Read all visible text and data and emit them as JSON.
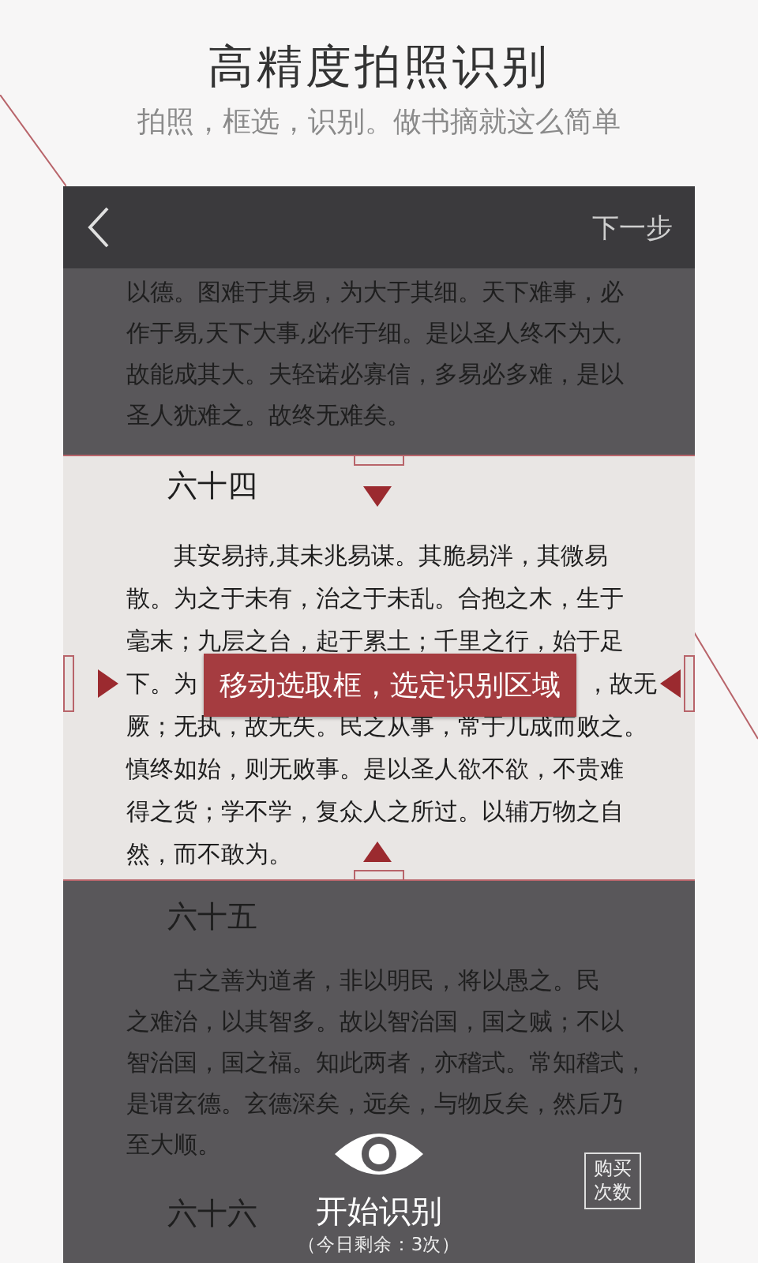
{
  "promo": {
    "title": "高精度拍照识别",
    "subtitle": "拍照，框选，识别。做书摘就这么简单"
  },
  "toolbar": {
    "next": "下一步"
  },
  "text_above": {
    "lines": [
      {
        "text": "以德。图难于其易，为大于其细。天下难事，必",
        "indent": false
      },
      {
        "text": "作于易,天下大事,必作于细。是以圣人终不为大,",
        "indent": false
      },
      {
        "text": "故能成其大。夫轻诺必寡信，多易必多难，是以",
        "indent": false
      },
      {
        "text": "圣人犹难之。故终无难矣。",
        "indent": false
      }
    ]
  },
  "selection": {
    "heading": "六十四",
    "lines_before": [
      {
        "text": "其安易持,其未兆易谋。其脆易泮，其微易",
        "indent": true
      },
      {
        "text": "散。为之于未有，治之于未乱。合抱之木，生于",
        "indent": false
      },
      {
        "text": "毫末；九层之台，起于累土；千里之行，始于足",
        "indent": false
      }
    ],
    "covered_line": {
      "before": "下。为",
      "after": "，故无"
    },
    "tooltip": "移动选取框，选定识别区域",
    "lines_after": [
      {
        "text": "厥；无执，故无失。民之从事，常于几成而败之。",
        "indent": false
      },
      {
        "text": "慎终如始，则无败事。是以圣人欲不欲，不贵难",
        "indent": false
      },
      {
        "text": "得之货；学不学，复众人之所过。以辅万物之自",
        "indent": false
      },
      {
        "text": "然，而不敢为。",
        "indent": false
      }
    ]
  },
  "text_below": {
    "heading": "六十五",
    "lines": [
      {
        "text": "古之善为道者，非以明民，将以愚之。民",
        "indent": true
      },
      {
        "text": "之难治，以其智多。故以智治国，国之贼；不以",
        "indent": false
      },
      {
        "text": "智治国，国之福。知此两者，亦稽式。常知稽式，",
        "indent": false
      },
      {
        "text": "是谓玄德。玄德深矣，远矣，与物反矣，然后乃",
        "indent": false
      },
      {
        "text": "至大顺。",
        "indent": false
      }
    ],
    "next_heading": "六十六"
  },
  "scan": {
    "label": "开始识别",
    "remaining": "（今日剩余：3次）"
  },
  "buy_button": "购买次数"
}
